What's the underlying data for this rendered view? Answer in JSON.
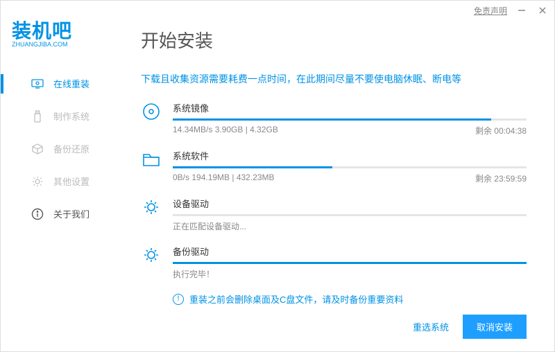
{
  "titlebar": {
    "disclaimer": "免责声明"
  },
  "logo": {
    "main": "装机吧",
    "sub": "ZHUANGJIBA.COM"
  },
  "sidebar": {
    "items": [
      {
        "label": "在线重装"
      },
      {
        "label": "制作系统"
      },
      {
        "label": "备份还原"
      },
      {
        "label": "其他设置"
      },
      {
        "label": "关于我们"
      }
    ]
  },
  "main": {
    "title": "开始安装",
    "hint": "下载且收集资源需要耗费一点时间，在此期间尽量不要使电脑休眠、断电等"
  },
  "tasks": [
    {
      "title": "系统镜像",
      "info_left": "14.34MB/s 3.90GB | 4.32GB",
      "info_right": "剩余 00:04:38",
      "progress": 90
    },
    {
      "title": "系统软件",
      "info_left": "0B/s 194.19MB | 432.23MB",
      "info_right": "剩余 23:59:59",
      "progress": 45
    },
    {
      "title": "设备驱动",
      "info_left": "正在匹配设备驱动...",
      "info_right": "",
      "progress": 0
    },
    {
      "title": "备份驱动",
      "info_left": "执行完毕！",
      "info_right": "",
      "progress": 100
    }
  ],
  "warning": "重装之前会删除桌面及C盘文件，请及时备份重要资料",
  "footer": {
    "reselect": "重选系统",
    "cancel": "取消安装"
  }
}
